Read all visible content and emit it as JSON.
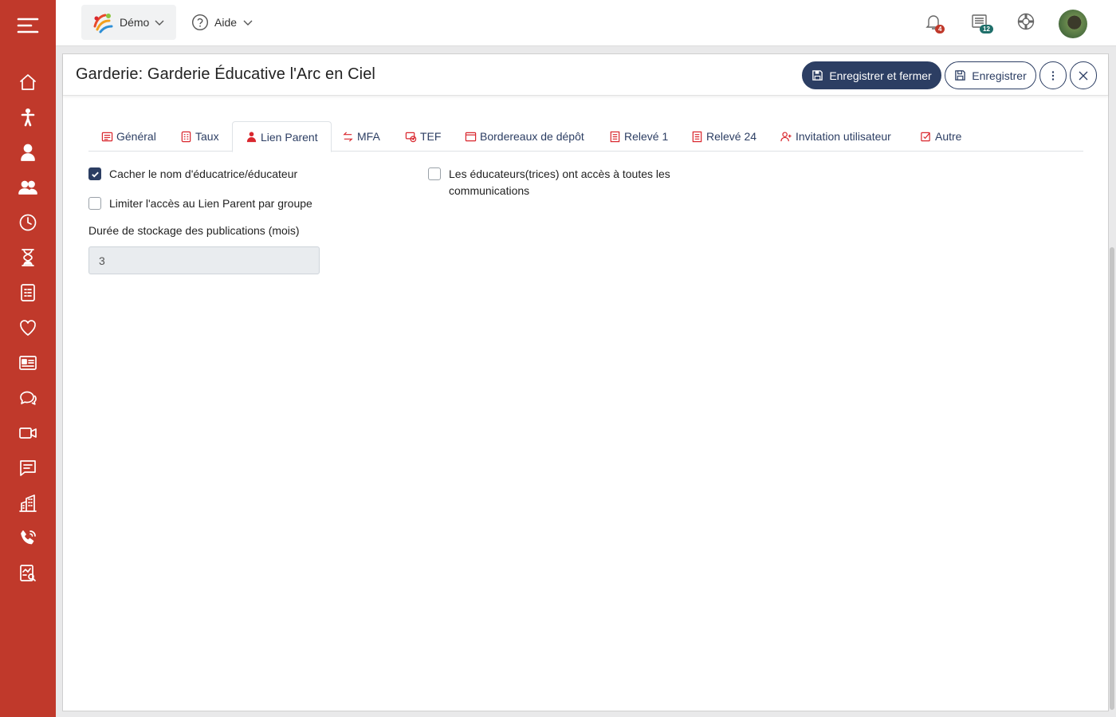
{
  "topbar": {
    "org_name": "Démo",
    "help_label": "Aide",
    "notifications_count": "4",
    "news_count": "12"
  },
  "sidebar": {
    "items": [
      "home-icon",
      "child-icon",
      "person-icon",
      "group-icon",
      "clock-icon",
      "hourglass-icon",
      "report-icon",
      "heart-icon",
      "id-card-icon",
      "chat-icon",
      "video-icon",
      "message-icon",
      "building-icon",
      "phone-icon",
      "analytics-icon"
    ]
  },
  "modal": {
    "title": "Garderie: Garderie Éducative l'Arc en Ciel",
    "save_close_label": "Enregistrer et fermer",
    "save_label": "Enregistrer"
  },
  "tabs": [
    {
      "label": "Général",
      "icon": "document-icon"
    },
    {
      "label": "Taux",
      "icon": "calculator-icon"
    },
    {
      "label": "Lien Parent",
      "icon": "parent-icon",
      "active": true
    },
    {
      "label": "MFA",
      "icon": "swap-icon"
    },
    {
      "label": "TEF",
      "icon": "bank-icon"
    },
    {
      "label": "Bordereaux de dépôt",
      "icon": "window-icon"
    },
    {
      "label": "Relevé 1",
      "icon": "list-icon"
    },
    {
      "label": "Relevé 24",
      "icon": "list-icon"
    },
    {
      "label": "Invitation utilisateur",
      "icon": "user-plus-icon"
    },
    {
      "label": "Autre",
      "icon": "check-square-icon"
    }
  ],
  "form": {
    "hide_educator_name": {
      "label": "Cacher le nom d'éducatrice/éducateur",
      "checked": true
    },
    "limit_access_by_group": {
      "label": "Limiter l'accès au Lien Parent par groupe",
      "checked": false
    },
    "educators_access_line1": "Les éducateurs(trices) ont accès à toutes les",
    "educators_access_line2": "communications",
    "educators_access_checked": false,
    "storage_duration_label": "Durée de stockage des publications (mois)",
    "storage_duration_value": "3"
  },
  "colors": {
    "sidebar": "#c0392b",
    "primary": "#2c3e63",
    "tab_icon": "#d9272e",
    "notification_badge": "#c0392b",
    "news_badge": "#1f6f6a"
  }
}
